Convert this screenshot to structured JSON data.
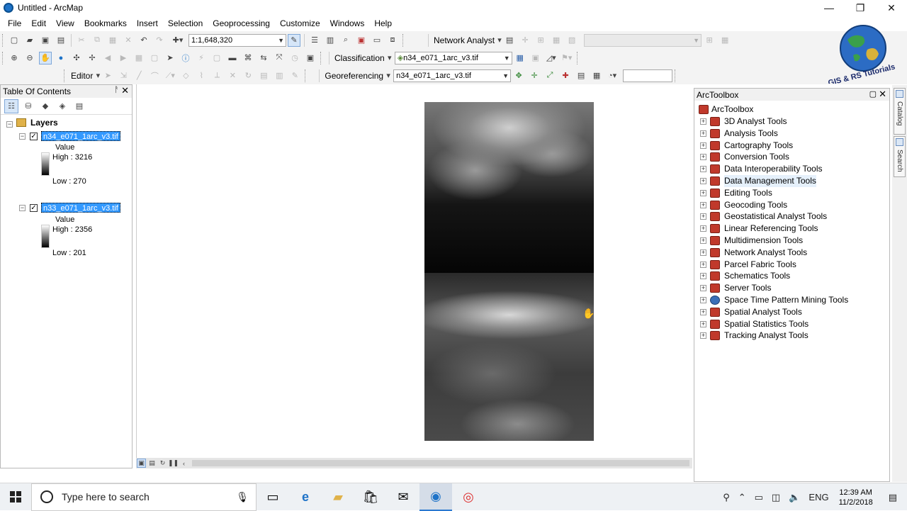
{
  "window": {
    "title": "Untitled - ArcMap",
    "minimize": "—",
    "restore": "❐",
    "close": "✕"
  },
  "menu": [
    "File",
    "Edit",
    "View",
    "Bookmarks",
    "Insert",
    "Selection",
    "Geoprocessing",
    "Customize",
    "Windows",
    "Help"
  ],
  "toolbar1": {
    "scale": "1:1,648,320",
    "network_analyst": "Network Analyst"
  },
  "toolbar2": {
    "classification": "Classification",
    "layer_combo": "n34_e071_1arc_v3.tif"
  },
  "toolbar3": {
    "editor": "Editor",
    "georeferencing": "Georeferencing",
    "layer_combo": "n34_e071_1arc_v3.tif"
  },
  "toc": {
    "title": "Table Of Contents",
    "group": "Layers",
    "layers": [
      {
        "name": "n34_e071_1arc_v3.tif",
        "value_label": "Value",
        "high": "High : 3216",
        "low": "Low : 270"
      },
      {
        "name": "n33_e071_1arc_v3.tif",
        "value_label": "Value",
        "high": "High : 2356",
        "low": "Low : 201"
      }
    ]
  },
  "arctoolbox": {
    "title": "ArcToolbox",
    "root": "ArcToolbox",
    "tools": [
      "3D Analyst Tools",
      "Analysis Tools",
      "Cartography Tools",
      "Conversion Tools",
      "Data Interoperability Tools",
      "Data Management Tools",
      "Editing Tools",
      "Geocoding Tools",
      "Geostatistical Analyst Tools",
      "Linear Referencing Tools",
      "Multidimension Tools",
      "Network Analyst Tools",
      "Parcel Fabric Tools",
      "Schematics Tools",
      "Server Tools",
      "Space Time Pattern Mining Tools",
      "Spatial Analyst Tools",
      "Spatial Statistics Tools",
      "Tracking Analyst Tools"
    ],
    "highlighted": "Data Management Tools"
  },
  "side_tabs": [
    "Catalog",
    "Search"
  ],
  "logo_text": "GIS & RS Tutorials",
  "taskbar": {
    "search_placeholder": "Type here to search",
    "lang": "ENG",
    "time": "12:39 AM",
    "date": "11/2/2018"
  }
}
